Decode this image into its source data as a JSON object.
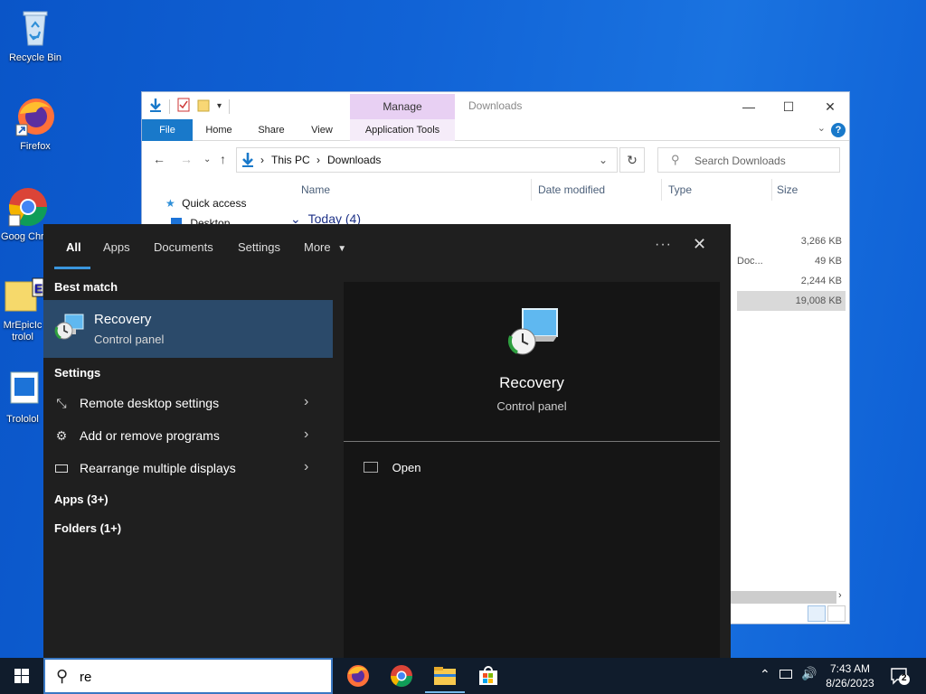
{
  "desktop": {
    "icons": [
      {
        "label": "Recycle Bin"
      },
      {
        "label": "Firefox"
      },
      {
        "label": "Goog Chron"
      },
      {
        "label": "MrEpicIc trolol"
      },
      {
        "label": "Trololol"
      }
    ]
  },
  "explorer": {
    "title": "Downloads",
    "manage_tab": "Manage",
    "ribbon_tabs": [
      "File",
      "Home",
      "Share",
      "View",
      "Application Tools"
    ],
    "breadcrumb": [
      "This PC",
      "Downloads"
    ],
    "search_placeholder": "Search Downloads",
    "columns": [
      "Name",
      "Date modified",
      "Type",
      "Size"
    ],
    "nav_pane": [
      "Quick access",
      "Desktop"
    ],
    "group_header": "Today (4)",
    "partial_type": "Doc...",
    "sizes": [
      "3,266 KB",
      "49 KB",
      "2,244 KB",
      "19,008 KB"
    ]
  },
  "search_panel": {
    "tabs": [
      "All",
      "Apps",
      "Documents",
      "Settings",
      "More"
    ],
    "more_icon": "ellipsis-icon",
    "best_match_heading": "Best match",
    "best_match": {
      "title": "Recovery",
      "subtitle": "Control panel"
    },
    "settings_heading": "Settings",
    "settings_items": [
      {
        "label": "Remote desktop settings",
        "icon": "remote-desktop-icon"
      },
      {
        "label": "Add or remove programs",
        "icon": "gear-icon"
      },
      {
        "label": "Rearrange multiple displays",
        "icon": "display-icon"
      }
    ],
    "apps_heading": "Apps (3+)",
    "folders_heading": "Folders (1+)",
    "preview": {
      "title": "Recovery",
      "subtitle": "Control panel",
      "action": "Open"
    }
  },
  "taskbar": {
    "search_value": "re",
    "time": "7:43 AM",
    "date": "8/26/2023",
    "notification_count": "2",
    "accent": "#3a78c3"
  }
}
